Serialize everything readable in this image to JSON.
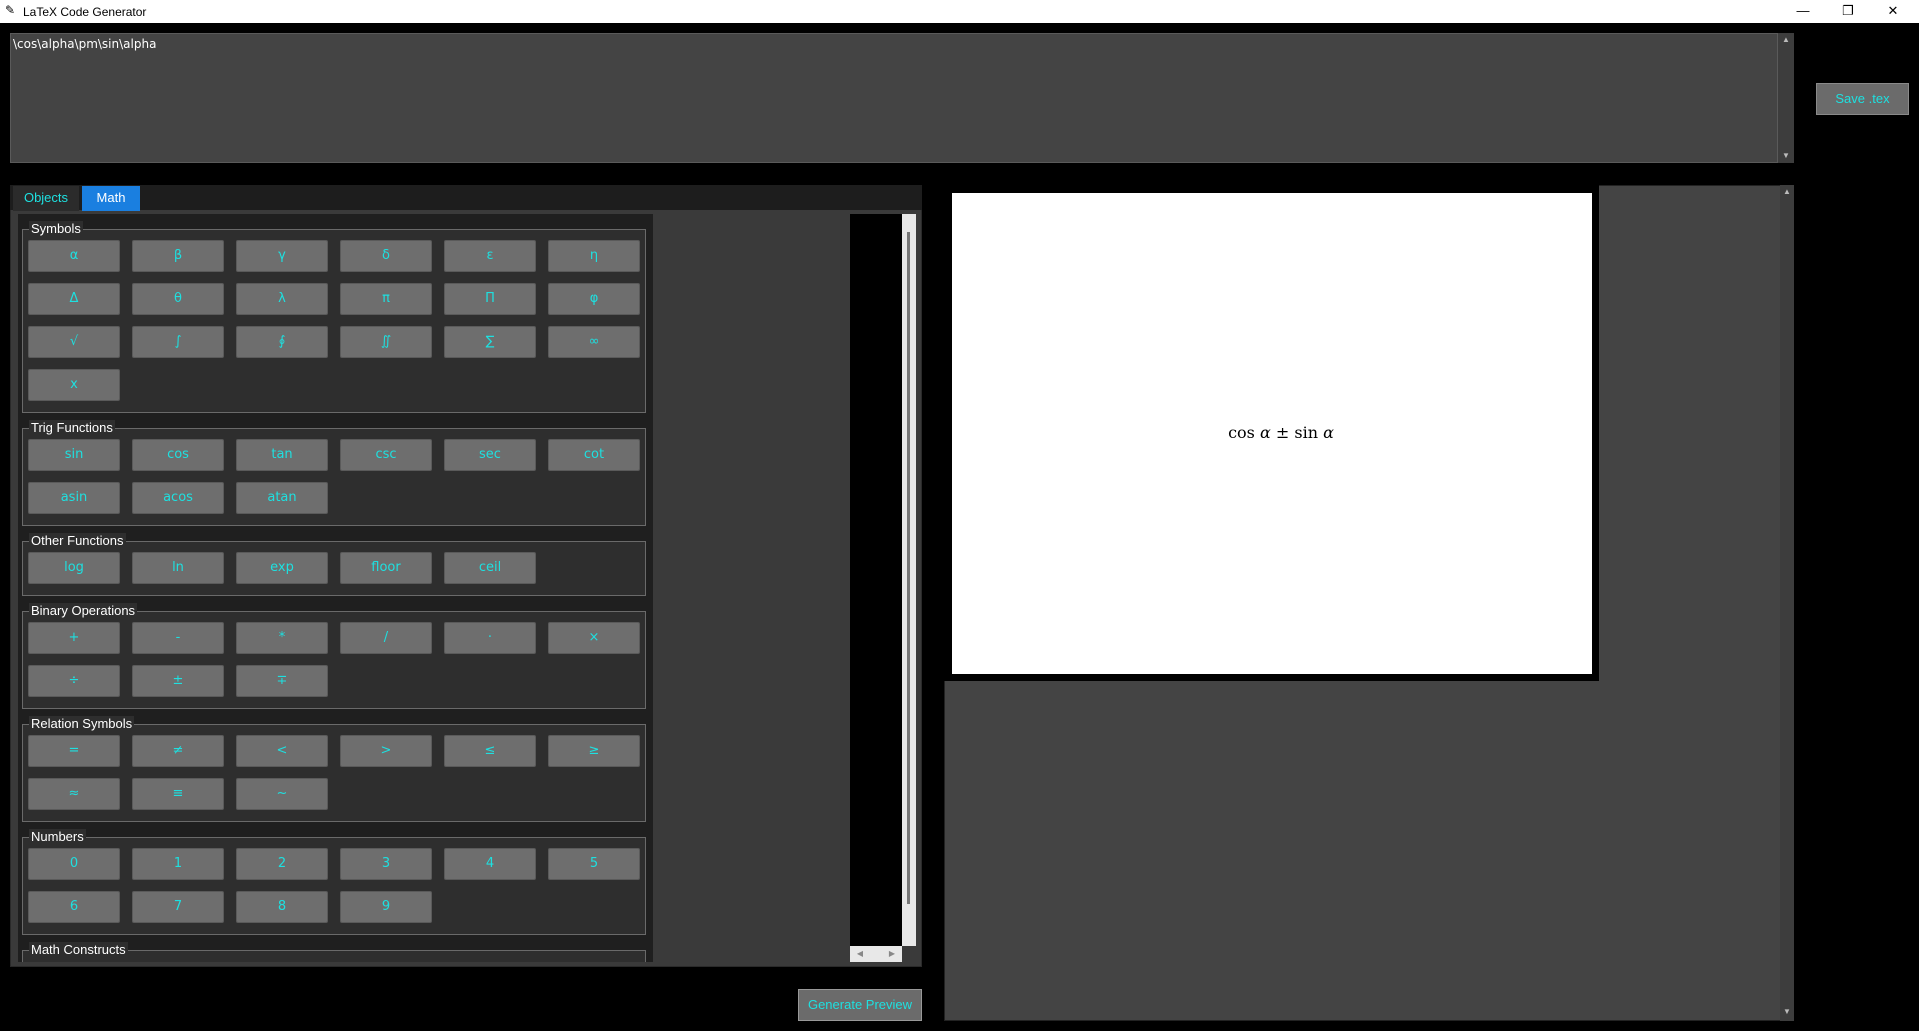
{
  "window": {
    "title": "LaTeX Code Generator",
    "minimize": "—",
    "maximize": "❐",
    "close": "✕",
    "app_icon": "✎"
  },
  "editor": {
    "code": "\\cos\\alpha\\pm\\sin\\alpha"
  },
  "toolbar": {
    "save_label": "Save .tex",
    "generate_label": "Generate Preview"
  },
  "tabs": [
    "Objects",
    "Math"
  ],
  "groups": [
    {
      "label": "Symbols",
      "buttons": [
        "α",
        "β",
        "γ",
        "δ",
        "ε",
        "η",
        "Δ",
        "θ",
        "λ",
        "π",
        "Π",
        "φ",
        "√",
        "∫",
        "∮",
        "∬",
        "∑",
        "∞",
        "x"
      ]
    },
    {
      "label": "Trig Functions",
      "buttons": [
        "sin",
        "cos",
        "tan",
        "csc",
        "sec",
        "cot",
        "asin",
        "acos",
        "atan"
      ]
    },
    {
      "label": "Other Functions",
      "buttons": [
        "log",
        "ln",
        "exp",
        "floor",
        "ceil"
      ]
    },
    {
      "label": "Binary Operations",
      "buttons": [
        "+",
        "-",
        "*",
        "/",
        "·",
        "×",
        "÷",
        "±",
        "∓"
      ]
    },
    {
      "label": "Relation Symbols",
      "buttons": [
        "=",
        "≠",
        "<",
        ">",
        "≤",
        "≥",
        "≈",
        "≡",
        "~"
      ]
    },
    {
      "label": "Numbers",
      "buttons": [
        "0",
        "1",
        "2",
        "3",
        "4",
        "5",
        "6",
        "7",
        "8",
        "9"
      ]
    },
    {
      "label": "Math Constructs",
      "buttons": []
    }
  ],
  "preview": {
    "parts": [
      "cos",
      "α",
      " ± ",
      "sin",
      "α"
    ]
  }
}
